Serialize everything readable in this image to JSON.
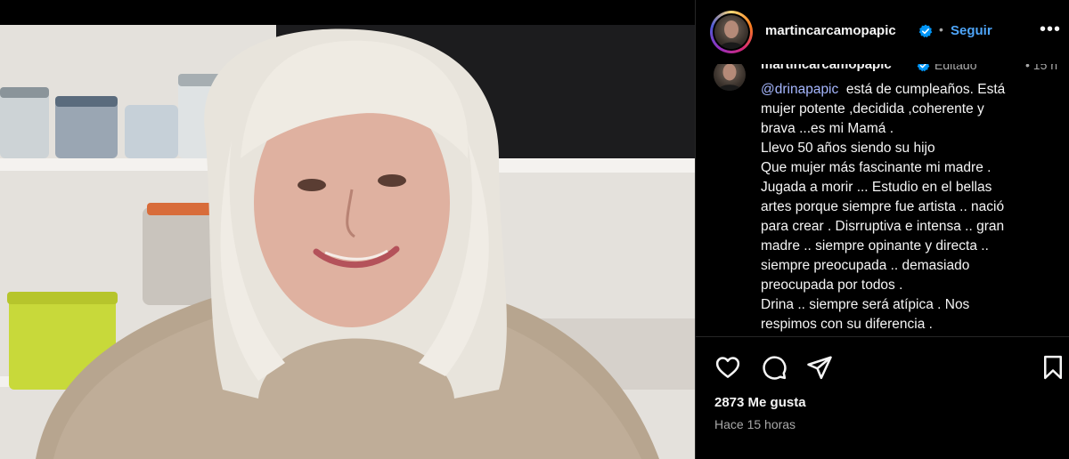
{
  "post": {
    "username": "martincarcamopapic",
    "follow_label": "Seguir",
    "separator": "•",
    "more_label": "•••"
  },
  "caption": {
    "username": "martincarcamopapic",
    "edited_label": "Editado",
    "time_label": "• 15 h",
    "mention": "@drinapapic",
    "lines": [
      "está de cumpleaños.  Está",
      "mujer potente ,decidida ,coherente y",
      "brava ...es mi Mamá .",
      "Llevo 50 años siendo su hijo",
      "Que mujer más fascinante mi madre .",
      "Jugada a morir ... Estudio en el bellas",
      "artes porque siempre fue artista .. nació",
      "para crear . Disrruptiva e intensa .. gran",
      "madre .. siempre opinante y directa ..",
      "siempre preocupada .. demasiado",
      "preocupada por todos .",
      "Drina .. siempre será atípica . Nos",
      "respimos con su diferencia ."
    ]
  },
  "footer": {
    "likes": "2873 Me gusta",
    "time_ago": "Hace 15 horas"
  },
  "icons": {
    "like": "heart-icon",
    "comment": "comment-icon",
    "share": "send-icon",
    "save": "bookmark-icon",
    "verified": "verified-badge-icon",
    "more": "more-options-icon"
  },
  "colors": {
    "background": "#000000",
    "text": "#f5f5f5",
    "muted": "#a8a8a8",
    "link": "#4ea5f9",
    "mention": "#a6b7ff",
    "verified": "#0095f6"
  }
}
